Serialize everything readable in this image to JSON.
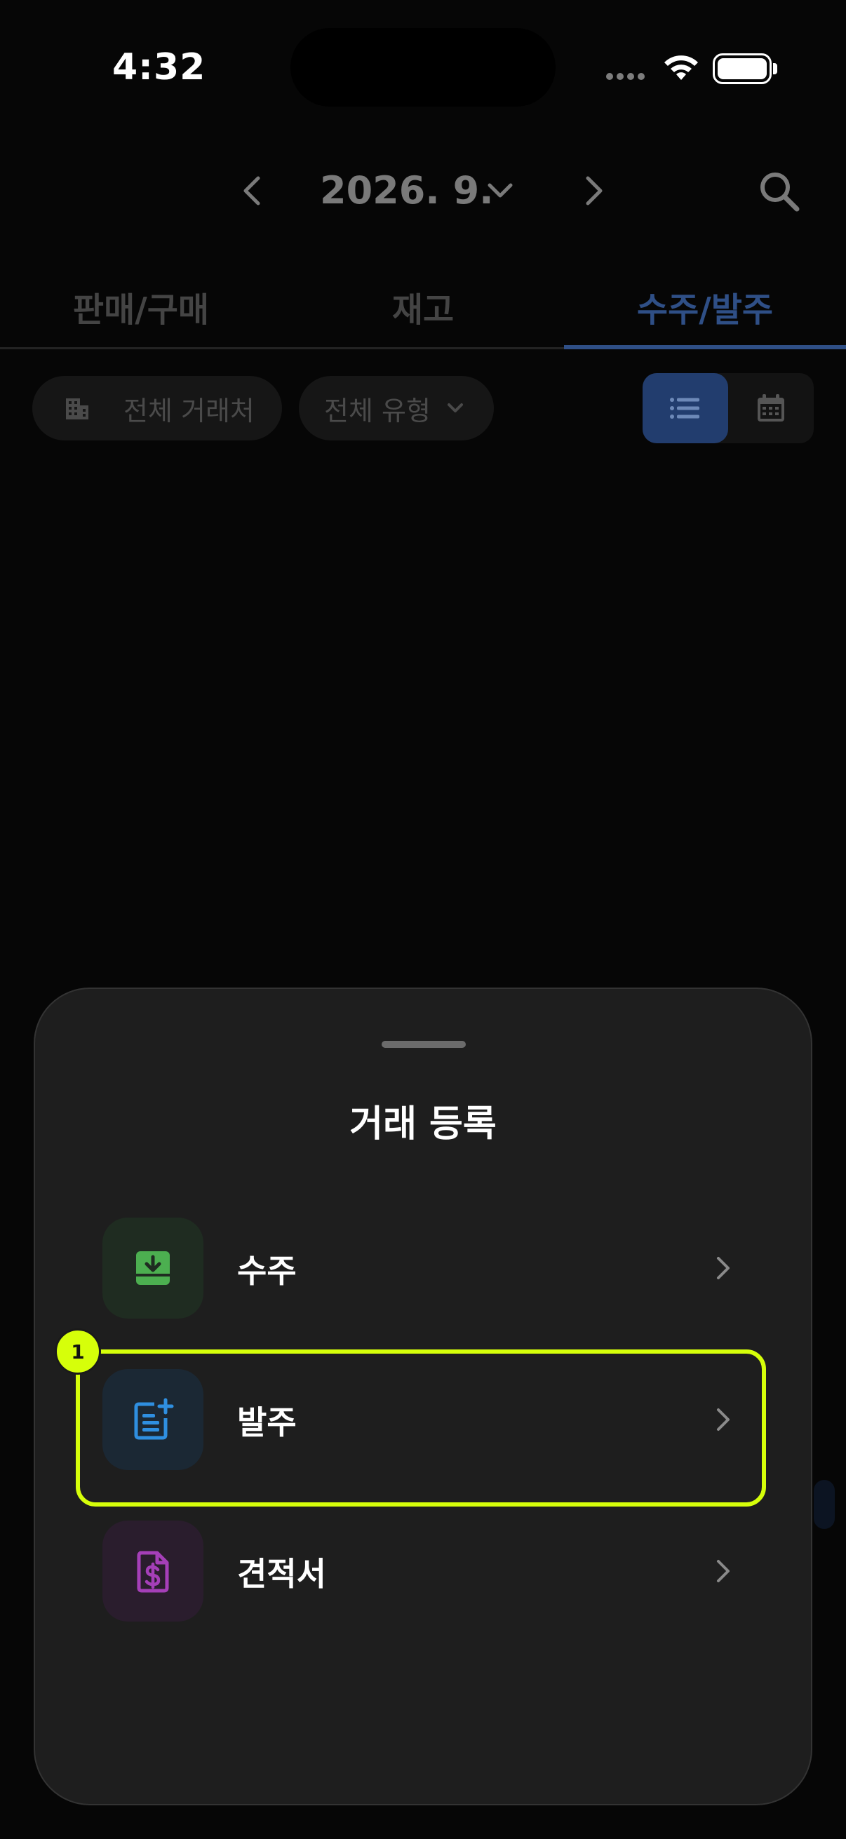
{
  "status_bar": {
    "time": "4:32"
  },
  "header": {
    "month": "2026. 9."
  },
  "tabs": [
    {
      "label": "판매/구매",
      "active": false
    },
    {
      "label": "재고",
      "active": false
    },
    {
      "label": "수주/발주",
      "active": true
    }
  ],
  "filters": {
    "partner_label": "전체 거래처",
    "type_label": "전체 유형",
    "view_mode": "list"
  },
  "sheet": {
    "title": "거래 등록",
    "items": [
      {
        "label": "수주",
        "icon": "inbox-download-icon",
        "color": "#4caf50"
      },
      {
        "label": "발주",
        "icon": "document-add-icon",
        "color": "#2f8fe0"
      },
      {
        "label": "견적서",
        "icon": "dollar-document-icon",
        "color": "#a53fb8"
      }
    ]
  },
  "annotation": {
    "badge": "1",
    "color": "#d6ff0a"
  },
  "colors": {
    "accent": "#2f4f86",
    "background": "#060606",
    "sheet": "#1e1e1e"
  }
}
